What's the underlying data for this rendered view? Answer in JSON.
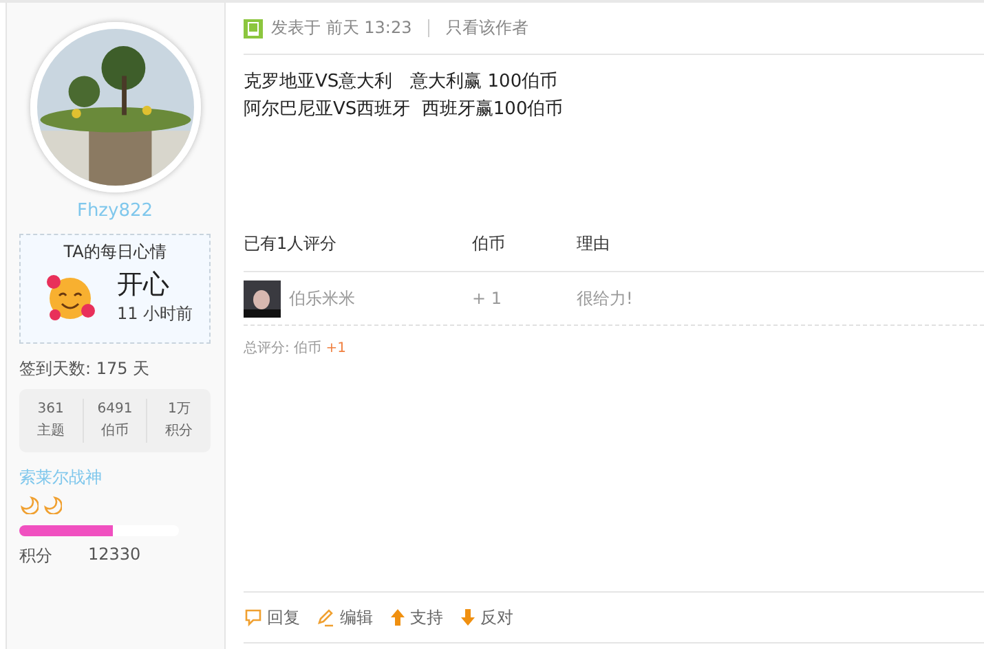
{
  "profile": {
    "username": "Fhzy822",
    "mood": {
      "title": "TA的每日心情",
      "mood": "开心",
      "time": "11 小时前"
    },
    "sign_in": "签到天数: 175 天",
    "stats": [
      {
        "value": "361",
        "label": "主题"
      },
      {
        "value": "6491",
        "label": "伯币"
      },
      {
        "value": "1万",
        "label": "积分"
      }
    ],
    "rank": "索莱尔战神",
    "rank_icons": [
      {
        "kind": "moon"
      },
      {
        "kind": "moon"
      }
    ],
    "progress": {
      "level": 0.59
    },
    "points_label": "积分",
    "points": "12330"
  },
  "post": {
    "posted": "发表于 前天 13:23",
    "author_only": "只看该作者",
    "lines": [
      "克罗地亚VS意大利　意大利赢 100伯币",
      "阿尔巴尼亚VS西班牙  西班牙赢100伯币"
    ],
    "rating": {
      "columns": [
        "已有1人评分",
        "伯币",
        "理由"
      ],
      "rows": [
        {
          "user": "伯乐米米",
          "coins": "+ 1",
          "reason": "很给力!"
        }
      ],
      "total_label": "总评分:  伯币",
      "total_value": "+1"
    },
    "actions": [
      {
        "kind": "reply",
        "label": "回复"
      },
      {
        "kind": "edit",
        "label": "编辑"
      },
      {
        "kind": "up",
        "label": "支持"
      },
      {
        "kind": "down",
        "label": "反对"
      }
    ]
  }
}
